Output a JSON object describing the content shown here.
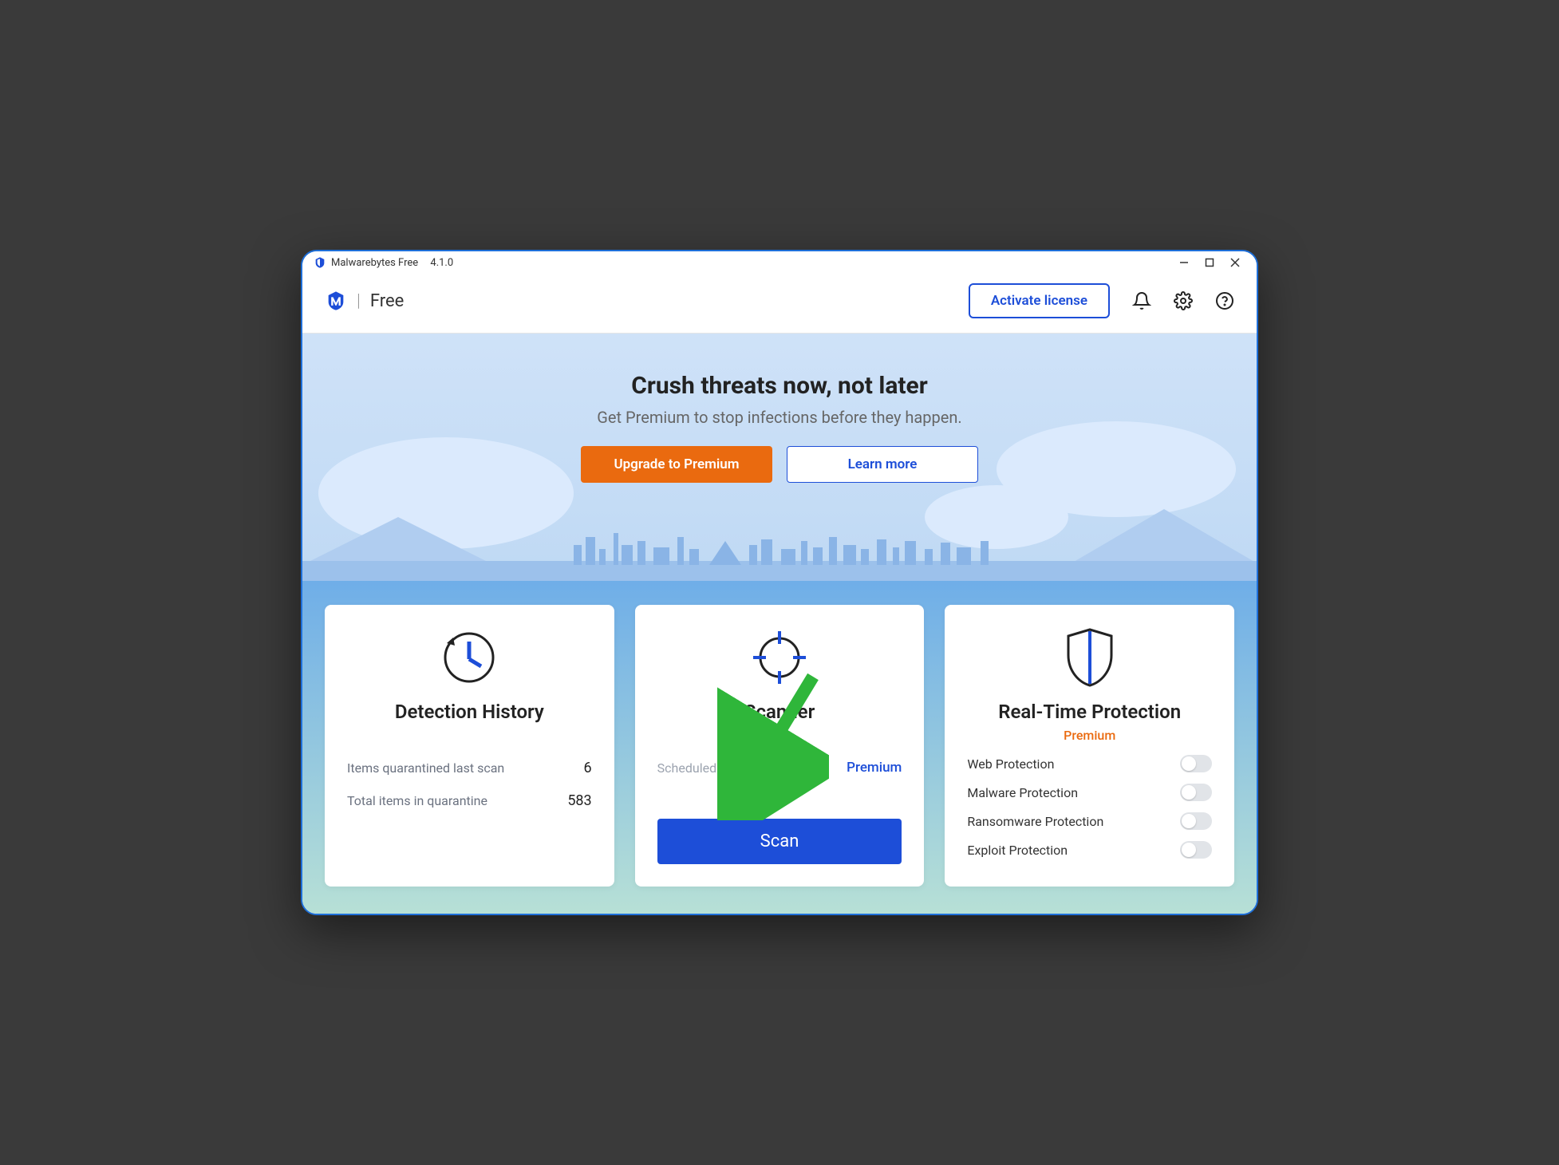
{
  "titlebar": {
    "app_name": "Malwarebytes Free",
    "version": "4.1.0"
  },
  "header": {
    "tier": "Free",
    "activate_label": "Activate license"
  },
  "hero": {
    "title": "Crush threats now, not later",
    "subtitle": "Get Premium to stop infections before they happen.",
    "upgrade_label": "Upgrade to Premium",
    "learn_label": "Learn more"
  },
  "cards": {
    "history": {
      "title": "Detection History",
      "row1_label": "Items quarantined last scan",
      "row1_value": "6",
      "row2_label": "Total items in quarantine",
      "row2_value": "583"
    },
    "scanner": {
      "title": "Scanner",
      "scheduled_label": "Scheduled scans",
      "scheduled_tag": "Premium",
      "scan_label": "Scan"
    },
    "protection": {
      "title": "Real-Time Protection",
      "premium_tag": "Premium",
      "items": [
        {
          "label": "Web Protection"
        },
        {
          "label": "Malware Protection"
        },
        {
          "label": "Ransomware Protection"
        },
        {
          "label": "Exploit Protection"
        }
      ]
    }
  }
}
